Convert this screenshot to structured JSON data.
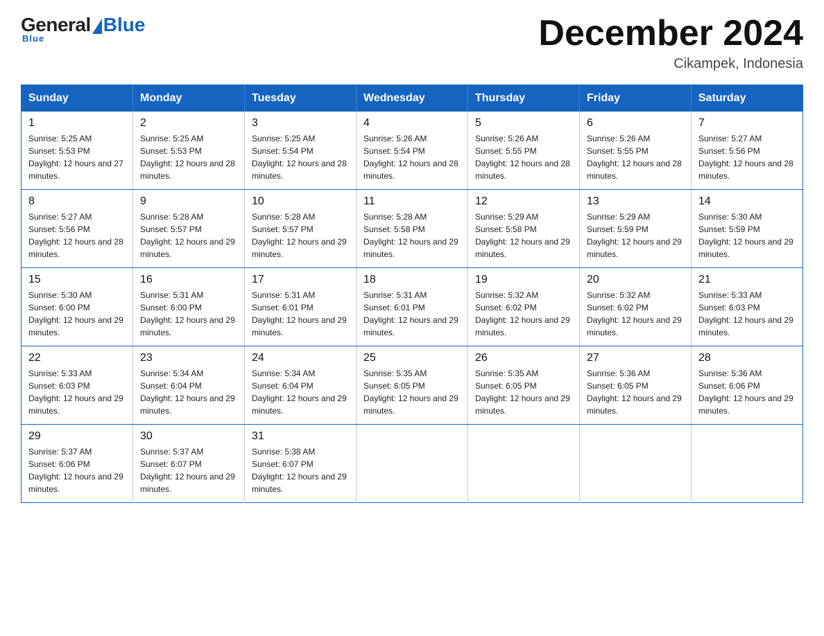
{
  "header": {
    "logo": {
      "general": "General",
      "blue": "Blue",
      "underline": "Blue"
    },
    "title": "December 2024",
    "location": "Cikampek, Indonesia"
  },
  "calendar": {
    "days_of_week": [
      "Sunday",
      "Monday",
      "Tuesday",
      "Wednesday",
      "Thursday",
      "Friday",
      "Saturday"
    ],
    "weeks": [
      [
        {
          "day": "1",
          "sunrise": "5:25 AM",
          "sunset": "5:53 PM",
          "daylight": "12 hours and 27 minutes."
        },
        {
          "day": "2",
          "sunrise": "5:25 AM",
          "sunset": "5:53 PM",
          "daylight": "12 hours and 28 minutes."
        },
        {
          "day": "3",
          "sunrise": "5:25 AM",
          "sunset": "5:54 PM",
          "daylight": "12 hours and 28 minutes."
        },
        {
          "day": "4",
          "sunrise": "5:26 AM",
          "sunset": "5:54 PM",
          "daylight": "12 hours and 28 minutes."
        },
        {
          "day": "5",
          "sunrise": "5:26 AM",
          "sunset": "5:55 PM",
          "daylight": "12 hours and 28 minutes."
        },
        {
          "day": "6",
          "sunrise": "5:26 AM",
          "sunset": "5:55 PM",
          "daylight": "12 hours and 28 minutes."
        },
        {
          "day": "7",
          "sunrise": "5:27 AM",
          "sunset": "5:56 PM",
          "daylight": "12 hours and 28 minutes."
        }
      ],
      [
        {
          "day": "8",
          "sunrise": "5:27 AM",
          "sunset": "5:56 PM",
          "daylight": "12 hours and 28 minutes."
        },
        {
          "day": "9",
          "sunrise": "5:28 AM",
          "sunset": "5:57 PM",
          "daylight": "12 hours and 29 minutes."
        },
        {
          "day": "10",
          "sunrise": "5:28 AM",
          "sunset": "5:57 PM",
          "daylight": "12 hours and 29 minutes."
        },
        {
          "day": "11",
          "sunrise": "5:28 AM",
          "sunset": "5:58 PM",
          "daylight": "12 hours and 29 minutes."
        },
        {
          "day": "12",
          "sunrise": "5:29 AM",
          "sunset": "5:58 PM",
          "daylight": "12 hours and 29 minutes."
        },
        {
          "day": "13",
          "sunrise": "5:29 AM",
          "sunset": "5:59 PM",
          "daylight": "12 hours and 29 minutes."
        },
        {
          "day": "14",
          "sunrise": "5:30 AM",
          "sunset": "5:59 PM",
          "daylight": "12 hours and 29 minutes."
        }
      ],
      [
        {
          "day": "15",
          "sunrise": "5:30 AM",
          "sunset": "6:00 PM",
          "daylight": "12 hours and 29 minutes."
        },
        {
          "day": "16",
          "sunrise": "5:31 AM",
          "sunset": "6:00 PM",
          "daylight": "12 hours and 29 minutes."
        },
        {
          "day": "17",
          "sunrise": "5:31 AM",
          "sunset": "6:01 PM",
          "daylight": "12 hours and 29 minutes."
        },
        {
          "day": "18",
          "sunrise": "5:31 AM",
          "sunset": "6:01 PM",
          "daylight": "12 hours and 29 minutes."
        },
        {
          "day": "19",
          "sunrise": "5:32 AM",
          "sunset": "6:02 PM",
          "daylight": "12 hours and 29 minutes."
        },
        {
          "day": "20",
          "sunrise": "5:32 AM",
          "sunset": "6:02 PM",
          "daylight": "12 hours and 29 minutes."
        },
        {
          "day": "21",
          "sunrise": "5:33 AM",
          "sunset": "6:03 PM",
          "daylight": "12 hours and 29 minutes."
        }
      ],
      [
        {
          "day": "22",
          "sunrise": "5:33 AM",
          "sunset": "6:03 PM",
          "daylight": "12 hours and 29 minutes."
        },
        {
          "day": "23",
          "sunrise": "5:34 AM",
          "sunset": "6:04 PM",
          "daylight": "12 hours and 29 minutes."
        },
        {
          "day": "24",
          "sunrise": "5:34 AM",
          "sunset": "6:04 PM",
          "daylight": "12 hours and 29 minutes."
        },
        {
          "day": "25",
          "sunrise": "5:35 AM",
          "sunset": "6:05 PM",
          "daylight": "12 hours and 29 minutes."
        },
        {
          "day": "26",
          "sunrise": "5:35 AM",
          "sunset": "6:05 PM",
          "daylight": "12 hours and 29 minutes."
        },
        {
          "day": "27",
          "sunrise": "5:36 AM",
          "sunset": "6:05 PM",
          "daylight": "12 hours and 29 minutes."
        },
        {
          "day": "28",
          "sunrise": "5:36 AM",
          "sunset": "6:06 PM",
          "daylight": "12 hours and 29 minutes."
        }
      ],
      [
        {
          "day": "29",
          "sunrise": "5:37 AM",
          "sunset": "6:06 PM",
          "daylight": "12 hours and 29 minutes."
        },
        {
          "day": "30",
          "sunrise": "5:37 AM",
          "sunset": "6:07 PM",
          "daylight": "12 hours and 29 minutes."
        },
        {
          "day": "31",
          "sunrise": "5:38 AM",
          "sunset": "6:07 PM",
          "daylight": "12 hours and 29 minutes."
        },
        null,
        null,
        null,
        null
      ]
    ]
  }
}
